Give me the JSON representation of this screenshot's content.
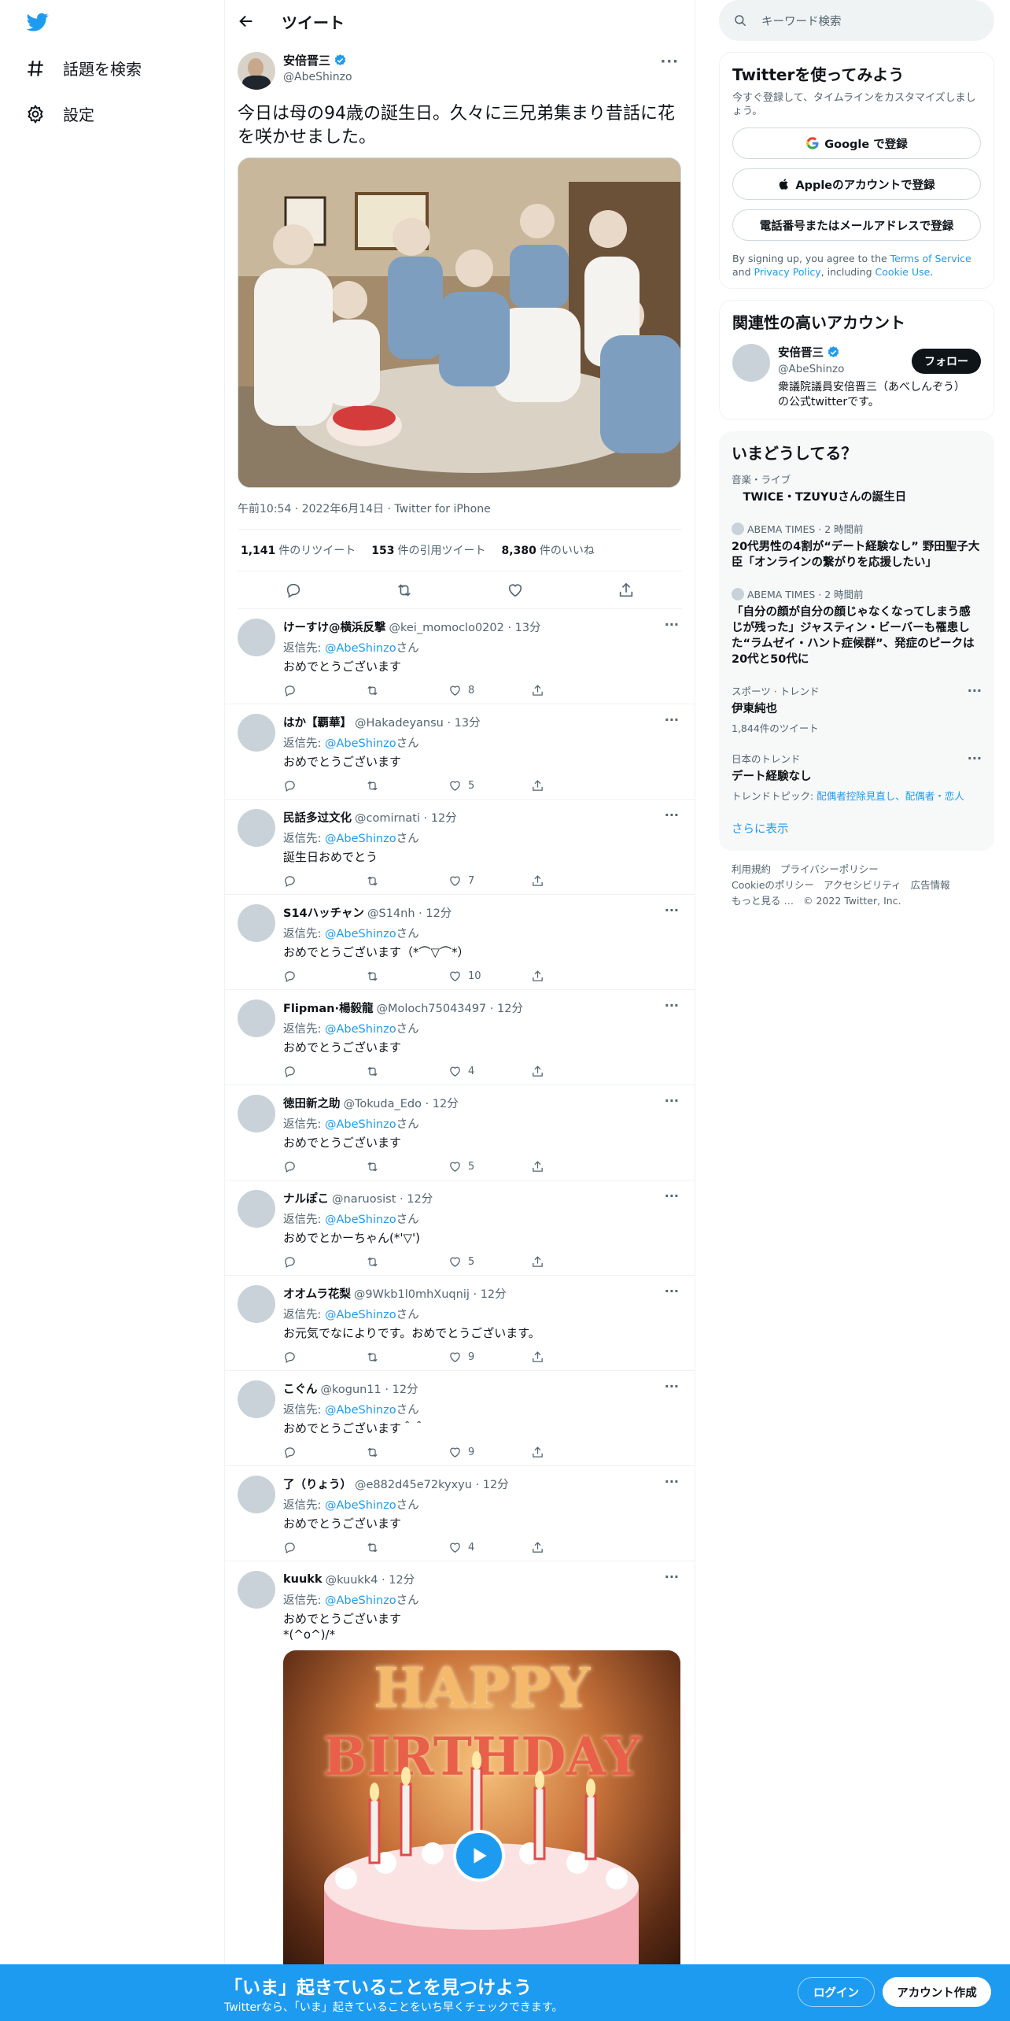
{
  "nav": {
    "explore": "話題を検索",
    "settings": "設定"
  },
  "header": {
    "title": "ツイート"
  },
  "tweet": {
    "author_name": "安倍晋三",
    "author_handle": "@AbeShinzo",
    "text": "今日は母の94歳の誕生日。久々に三兄弟集まり昔話に花を咲かせました。",
    "meta": "午前10:54 · 2022年6月14日 · Twitter for iPhone",
    "retweets_num": "1,141",
    "retweets_label": "件のリツイート",
    "quotes_num": "153",
    "quotes_label": "件の引用ツイート",
    "likes_num": "8,380",
    "likes_label": "件のいいね"
  },
  "reply_prefix": "返信先: ",
  "reply_to": "@AbeShinzo",
  "reply_suffix": "さん",
  "replies": [
    {
      "name": "けーすけ@横浜反撃",
      "handle": "@kei_momoclo0202 · 13分",
      "text": "おめでとうございます",
      "likes": "8"
    },
    {
      "name": "はか【覇華】",
      "handle": "@Hakadeyansu · 13分",
      "text": "おめでとうございます",
      "likes": "5"
    },
    {
      "name": "民話多过文化",
      "handle": "@comirnati · 12分",
      "text": "誕生日おめでとう",
      "likes": "7"
    },
    {
      "name": "S14ハッチャン",
      "handle": "@S14nh · 12分",
      "text": "おめでとうございます（*⌒▽⌒*）",
      "likes": "10"
    },
    {
      "name": "Flipman·楊毅龍",
      "handle": "@Moloch75043497 · 12分",
      "text": "おめでとうございます",
      "likes": "4"
    },
    {
      "name": "徳田新之助",
      "handle": "@Tokuda_Edo · 12分",
      "text": "おめでとうございます",
      "likes": "5"
    },
    {
      "name": "ナルぽこ",
      "handle": "@naruosist · 12分",
      "text": "おめでとかーちゃん(*'▽')",
      "likes": "5"
    },
    {
      "name": "オオムラ花梨",
      "handle": "@9Wkb1l0mhXuqnij · 12分",
      "text": "お元気でなによりです。おめでとうございます。",
      "likes": "9"
    },
    {
      "name": "こぐん",
      "handle": "@kogun11 · 12分",
      "text": "おめでとうございます＾＾",
      "likes": "9"
    },
    {
      "name": "了（りょう）",
      "handle": "@e882d45e72kyxyu · 12分",
      "text": "おめでとうございます",
      "likes": "4"
    }
  ],
  "last_reply": {
    "name": "kuukk",
    "handle": "@kuukk4 · 12分",
    "line1": "おめでとうございます",
    "line2": "*(^o^)/*",
    "video_text1": "HAPPY",
    "video_text2": "BIRTHDAY"
  },
  "search": {
    "placeholder": "キーワード検索"
  },
  "signup_card": {
    "title": "Twitterを使ってみよう",
    "sub": "今すぐ登録して、タイムラインをカスタマイズしましょう。",
    "google": "Google で登録",
    "apple": "Appleのアカウントで登録",
    "phone": "電話番号またはメールアドレスで登録",
    "legal_1": "By signing up, you agree to the ",
    "legal_tos": "Terms of Service",
    "legal_2": " and ",
    "legal_privacy": "Privacy Policy",
    "legal_3": ", including ",
    "legal_cookie": "Cookie Use",
    "legal_4": "."
  },
  "related": {
    "title": "関連性の高いアカウント",
    "name": "安倍晋三",
    "handle": "@AbeShinzo",
    "bio": "衆議院議員安倍晋三（あべしんぞう）の公式twitterです。",
    "follow": "フォロー"
  },
  "trends": {
    "title": "いまどうしてる？",
    "items": [
      {
        "ctx": "音楽・ライブ",
        "title": "　TWICE・TZUYUさんの誕生日",
        "count": ""
      },
      {
        "ctx": "ABEMA TIMES · 2 時間前",
        "title": "20代男性の4割が“デート経験なし” 野田聖子大臣「オンラインの繋がりを応援したい」",
        "count": ""
      },
      {
        "ctx": "ABEMA TIMES · 2 時間前",
        "title": "「自分の顔が自分の顔じゃなくなってしまう感じが残った」ジャスティン・ビーバーも罹患した“ラムゼイ・ハント症候群”、発症のピークは20代と50代に",
        "count": ""
      },
      {
        "ctx": "スポーツ · トレンド",
        "title": "伊東純也",
        "count": "1,844件のツイート"
      },
      {
        "ctx": "日本のトレンド",
        "title": "デート経験なし",
        "count": ""
      }
    ],
    "trend_topics_label": "トレンドトピック: ",
    "trend_topics": "配偶者控除見直し、配偶者・恋人",
    "show_more": "さらに表示"
  },
  "footer": {
    "terms": "利用規約",
    "privacy": "プライバシーポリシー",
    "cookie": "Cookieのポリシー",
    "accessibility": "アクセシビリティ",
    "ads": "広告情報",
    "more": "もっと見る …",
    "copyright": "© 2022 Twitter, Inc."
  },
  "banner": {
    "title": "「いま」起きていることを見つけよう",
    "sub": "Twitterなら、「いま」起きていることをいち早くチェックできます。",
    "login": "ログイン",
    "signup": "アカウント作成"
  },
  "colors": {
    "accent": "#1d9bf0",
    "text": "#0f1419",
    "muted": "#536471"
  }
}
